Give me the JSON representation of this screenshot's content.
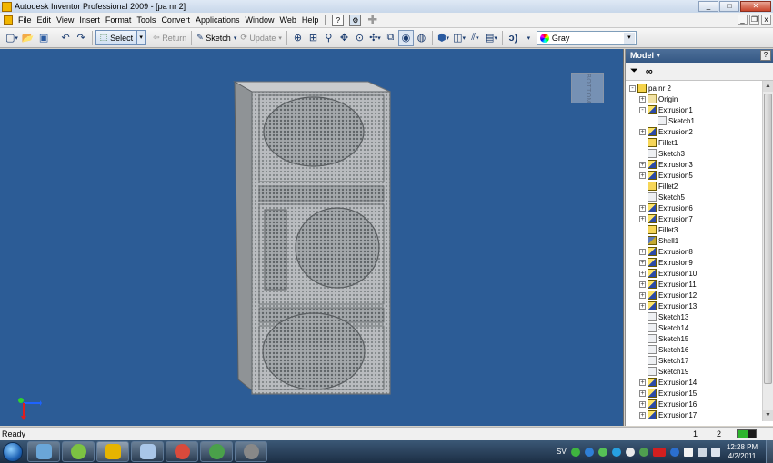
{
  "window": {
    "title": "Autodesk Inventor Professional 2009 - [pa nr 2]",
    "minimize": "_",
    "maximize": "□",
    "close": "✕"
  },
  "menu": {
    "items": [
      "File",
      "Edit",
      "View",
      "Insert",
      "Format",
      "Tools",
      "Convert",
      "Applications",
      "Window",
      "Web",
      "Help"
    ],
    "help_icon": "?",
    "mdi_min": "_",
    "mdi_restore": "❐",
    "mdi_close": "x"
  },
  "toolbar": {
    "select_label": "Select",
    "return_label": "Return",
    "sketch_label": "Sketch",
    "update_label": "Update",
    "color_value": "Gray"
  },
  "viewport": {
    "viewcube_label": "BOTTOM",
    "background": "#2c5c96"
  },
  "browser": {
    "title": "Model ▾",
    "help": "?",
    "filter_icon": "funnel-icon",
    "find_icon": "binoculars-icon",
    "tree": [
      {
        "label": "pa nr 2",
        "icon": "part",
        "level": 0,
        "expander": "-"
      },
      {
        "label": "Origin",
        "icon": "origin",
        "level": 1,
        "expander": "+"
      },
      {
        "label": "Extrusion1",
        "icon": "extrusion",
        "level": 1,
        "expander": "-"
      },
      {
        "label": "Sketch1",
        "icon": "sketch",
        "level": 2,
        "expander": ""
      },
      {
        "label": "Extrusion2",
        "icon": "extrusion",
        "level": 1,
        "expander": "+"
      },
      {
        "label": "Fillet1",
        "icon": "fillet",
        "level": 1,
        "expander": ""
      },
      {
        "label": "Sketch3",
        "icon": "sketch",
        "level": 1,
        "expander": ""
      },
      {
        "label": "Extrusion3",
        "icon": "extrusion",
        "level": 1,
        "expander": "+"
      },
      {
        "label": "Extrusion5",
        "icon": "extrusion",
        "level": 1,
        "expander": "+"
      },
      {
        "label": "Fillet2",
        "icon": "fillet",
        "level": 1,
        "expander": ""
      },
      {
        "label": "Sketch5",
        "icon": "sketch",
        "level": 1,
        "expander": ""
      },
      {
        "label": "Extrusion6",
        "icon": "extrusion",
        "level": 1,
        "expander": "+"
      },
      {
        "label": "Extrusion7",
        "icon": "extrusion",
        "level": 1,
        "expander": "+"
      },
      {
        "label": "Fillet3",
        "icon": "fillet",
        "level": 1,
        "expander": ""
      },
      {
        "label": "Shell1",
        "icon": "shell",
        "level": 1,
        "expander": ""
      },
      {
        "label": "Extrusion8",
        "icon": "extrusion",
        "level": 1,
        "expander": "+"
      },
      {
        "label": "Extrusion9",
        "icon": "extrusion",
        "level": 1,
        "expander": "+"
      },
      {
        "label": "Extrusion10",
        "icon": "extrusion",
        "level": 1,
        "expander": "+"
      },
      {
        "label": "Extrusion11",
        "icon": "extrusion",
        "level": 1,
        "expander": "+"
      },
      {
        "label": "Extrusion12",
        "icon": "extrusion",
        "level": 1,
        "expander": "+"
      },
      {
        "label": "Extrusion13",
        "icon": "extrusion",
        "level": 1,
        "expander": "+"
      },
      {
        "label": "Sketch13",
        "icon": "sketch",
        "level": 1,
        "expander": ""
      },
      {
        "label": "Sketch14",
        "icon": "sketch",
        "level": 1,
        "expander": ""
      },
      {
        "label": "Sketch15",
        "icon": "sketch",
        "level": 1,
        "expander": ""
      },
      {
        "label": "Sketch16",
        "icon": "sketch",
        "level": 1,
        "expander": ""
      },
      {
        "label": "Sketch17",
        "icon": "sketch",
        "level": 1,
        "expander": ""
      },
      {
        "label": "Sketch19",
        "icon": "sketch",
        "level": 1,
        "expander": ""
      },
      {
        "label": "Extrusion14",
        "icon": "extrusion",
        "level": 1,
        "expander": "+"
      },
      {
        "label": "Extrusion15",
        "icon": "extrusion",
        "level": 1,
        "expander": "+"
      },
      {
        "label": "Extrusion16",
        "icon": "extrusion",
        "level": 1,
        "expander": "+"
      },
      {
        "label": "Extrusion17",
        "icon": "extrusion",
        "level": 1,
        "expander": "+"
      }
    ]
  },
  "status": {
    "text": "Ready",
    "num1": "1",
    "num2": "2"
  },
  "taskbar": {
    "language": "SV",
    "time": "12:28 PM",
    "date": "4/2/2011",
    "apps": [
      {
        "name": "network-app-icon",
        "color": "#6aa6d8"
      },
      {
        "name": "spotify-icon",
        "color": "#7cc242"
      },
      {
        "name": "inventor-icon",
        "color": "#e6b400"
      },
      {
        "name": "calculator-icon",
        "color": "#a9c6e8"
      },
      {
        "name": "chrome-icon",
        "color": "#d94a3c"
      },
      {
        "name": "utorrent-icon",
        "color": "#4aa04a"
      },
      {
        "name": "media-icon",
        "color": "#888888"
      }
    ]
  }
}
